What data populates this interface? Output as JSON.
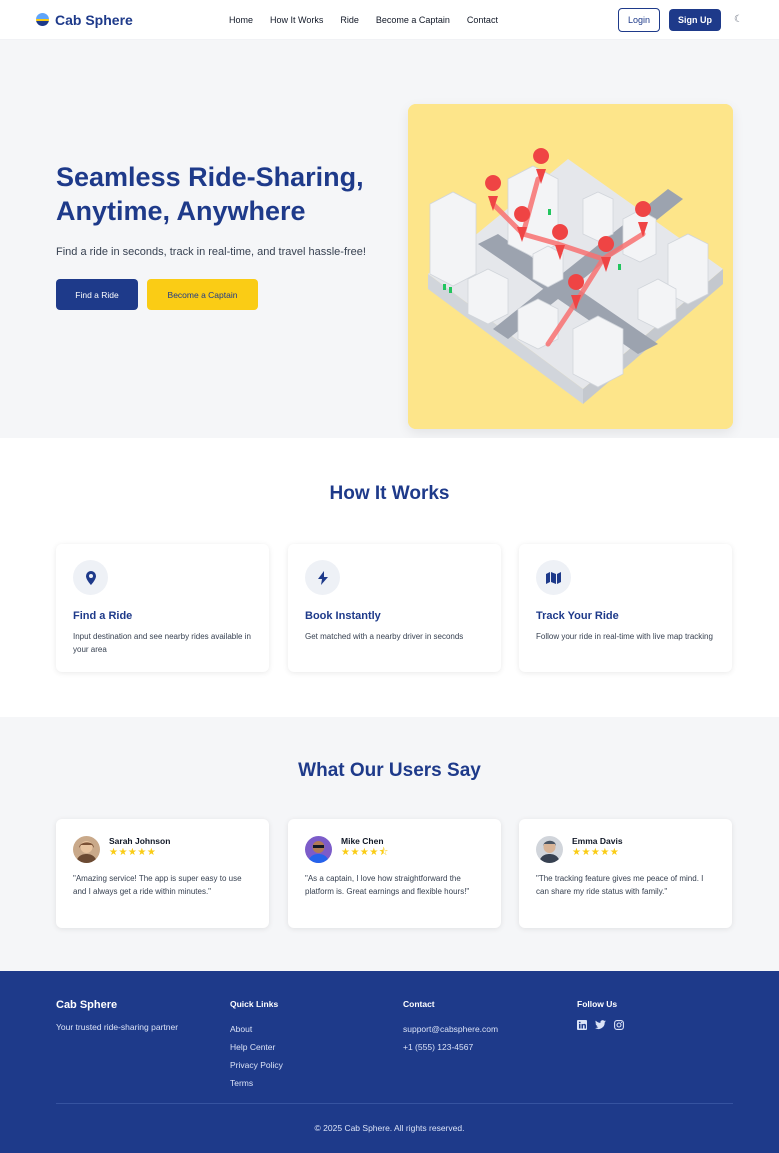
{
  "nav": {
    "brand": "Cab Sphere",
    "links": [
      "Home",
      "How It Works",
      "Ride",
      "Become a Captain",
      "Contact"
    ],
    "login_label": "Login",
    "signup_label": "Sign Up",
    "theme_icon": "moon-icon"
  },
  "hero": {
    "title_line1": "Seamless Ride-Sharing,",
    "title_line2": "Anytime, Anywhere",
    "subtitle": "Find a ride in seconds, track in real-time, and travel hassle-free!",
    "primary_button": "Find a Ride",
    "secondary_button": "Become a Captain",
    "image": "isometric-city-map-with-route-pins"
  },
  "how_it_works": {
    "title": "How It Works",
    "cards": [
      {
        "icon": "map-pin-icon",
        "title": "Find a Ride",
        "desc": "Input destination and see nearby rides available in your area"
      },
      {
        "icon": "bolt-icon",
        "title": "Book Instantly",
        "desc": "Get matched with a nearby driver in seconds"
      },
      {
        "icon": "map-icon",
        "title": "Track Your Ride",
        "desc": "Follow your ride in real-time with live map tracking"
      }
    ]
  },
  "testimonials": {
    "title": "What Our Users Say",
    "items": [
      {
        "name": "Sarah Johnson",
        "stars": "★★★★★",
        "rating": 5,
        "quote": "\"Amazing service! The app is super easy to use and I always get a ride within minutes.\""
      },
      {
        "name": "Mike Chen",
        "stars": "★★★★⯪",
        "rating": 4.5,
        "quote": "\"As a captain, I love how straightforward the platform is. Great earnings and flexible hours!\""
      },
      {
        "name": "Emma Davis",
        "stars": "★★★★★",
        "rating": 5,
        "quote": "\"The tracking feature gives me peace of mind. I can share my ride status with family.\""
      }
    ]
  },
  "footer": {
    "brand": "Cab Sphere",
    "tagline": "Your trusted ride-sharing partner",
    "quick_links_title": "Quick Links",
    "quick_links": [
      "About",
      "Help Center",
      "Privacy Policy",
      "Terms"
    ],
    "contact_title": "Contact",
    "email": "support@cabsphere.com",
    "phone": "+1 (555) 123-4567",
    "follow_title": "Follow Us",
    "social_icons": [
      "linkedin-icon",
      "twitter-icon",
      "instagram-icon"
    ],
    "copyright": "© 2025 Cab Sphere. All rights reserved."
  },
  "colors": {
    "primary": "#1e3a8a",
    "accent": "#facc15",
    "hero_bg": "#f5f6f8",
    "image_bg": "#fde68a",
    "pin": "#ef4444"
  }
}
